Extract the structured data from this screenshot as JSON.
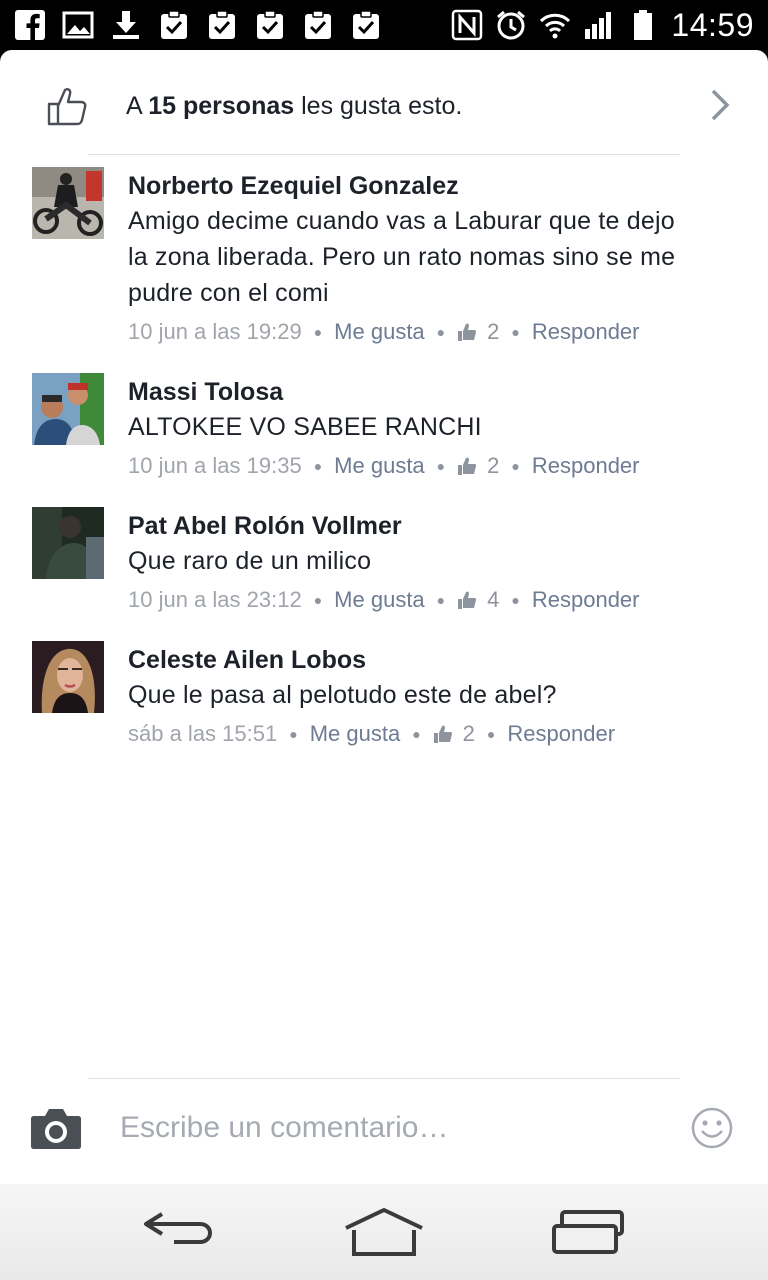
{
  "status_bar": {
    "time": "14:59",
    "left_icons": [
      "facebook-icon",
      "gallery-icon",
      "download-icon",
      "task-check-icon",
      "task-check-icon",
      "task-check-icon",
      "task-check-icon",
      "task-check-icon"
    ],
    "right_icons": [
      "nfc-icon",
      "alarm-icon",
      "wifi-icon",
      "signal-icon",
      "battery-icon"
    ]
  },
  "likes": {
    "prefix": "A",
    "count_text": "15 personas",
    "suffix": "les gusta esto."
  },
  "comments": [
    {
      "author": "Norberto Ezequiel Gonzalez",
      "text": "Amigo  decime cuando vas a Laburar  que te dejo la zona liberada. Pero un rato nomas sino se me pudre  con el comi",
      "time": "10 jun a las 19:29",
      "like_label": "Me gusta",
      "like_count": "2",
      "reply_label": "Responder"
    },
    {
      "author": "Massi Tolosa",
      "text": "ALTOKEE VO SABEE RANCHI",
      "time": "10 jun a las 19:35",
      "like_label": "Me gusta",
      "like_count": "2",
      "reply_label": "Responder"
    },
    {
      "author": "Pat Abel Rolón Vollmer",
      "text": "Que raro de un milico",
      "time": "10 jun a las 23:12",
      "like_label": "Me gusta",
      "like_count": "4",
      "reply_label": "Responder"
    },
    {
      "author": "Celeste Ailen Lobos",
      "text": "Que le pasa al pelotudo este de abel?",
      "time": "sáb a las 15:51",
      "like_label": "Me gusta",
      "like_count": "2",
      "reply_label": "Responder"
    }
  ],
  "composer": {
    "placeholder": "Escribe un comentario…",
    "camera_icon": "camera-icon",
    "emoji_icon": "smiley-icon"
  },
  "nav_bar": {
    "buttons": [
      "back-icon",
      "home-icon",
      "recent-apps-icon"
    ]
  },
  "colors": {
    "text": "#1d2129",
    "meta": "#a0a4ab",
    "action": "#6d7b93",
    "divider": "#dddfe2"
  }
}
